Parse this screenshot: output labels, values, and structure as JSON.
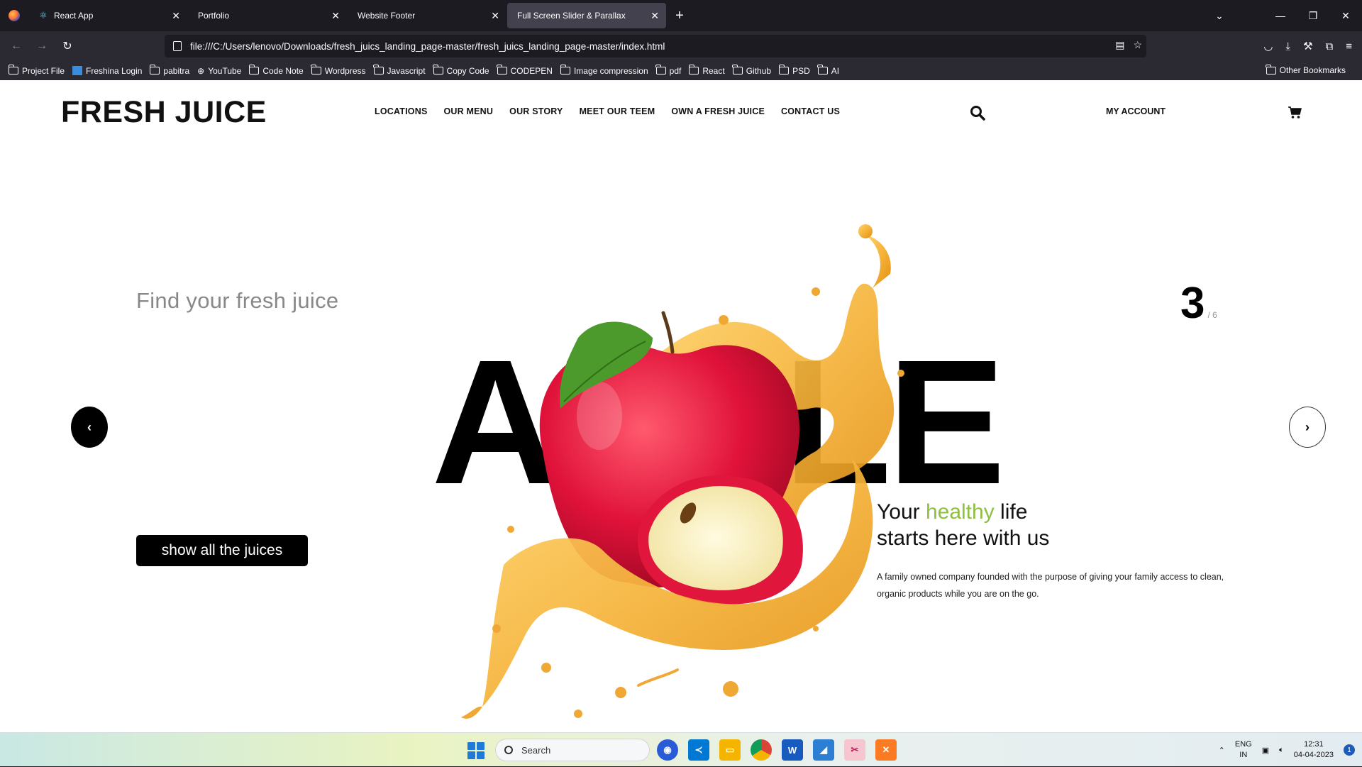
{
  "browser": {
    "tabs": [
      {
        "label": "React App",
        "icon": "react-icon",
        "active": false
      },
      {
        "label": "Portfolio",
        "icon": "",
        "active": false
      },
      {
        "label": "Website Footer",
        "icon": "",
        "active": false
      },
      {
        "label": "Full Screen Slider & Parallax",
        "icon": "",
        "active": true
      }
    ],
    "url": "file:///C:/Users/lenovo/Downloads/fresh_juics_landing_page-master/fresh_juics_landing_page-master/index.html",
    "bookmarks": [
      "Project File",
      "Freshina Login",
      "pabitra",
      "YouTube",
      "Code Note",
      "Wordpress",
      "Javascript",
      "Copy Code",
      "CODEPEN",
      "Image compression",
      "pdf",
      "React",
      "Github",
      "PSD",
      "AI"
    ],
    "other_bookmarks": "Other Bookmarks"
  },
  "site": {
    "logo": "FRESH JUICE",
    "nav": [
      "LOCATIONS",
      "OUR MENU",
      "OUR STORY",
      "MEET OUR TEEM",
      "OWN A FRESH JUICE",
      "CONTACT US"
    ],
    "my_account": "MY ACCOUNT",
    "tagline": "Find your fresh juice",
    "big_word": "APPLE",
    "slide_current": "3",
    "slide_total": "/ 6",
    "show_button": "show all the juices",
    "headline_pre": "Your ",
    "headline_green": "healthy",
    "headline_post": " life",
    "headline_line2": "starts here with us",
    "description": "A family owned company founded with the purpose of giving your family access to clean, organic products while you are on the go.",
    "accent_color": "#8ec03f"
  },
  "taskbar": {
    "search_placeholder": "Search",
    "lang_line1": "ENG",
    "lang_line2": "IN",
    "time": "12:31",
    "date": "04-04-2023",
    "notification_count": "1"
  }
}
